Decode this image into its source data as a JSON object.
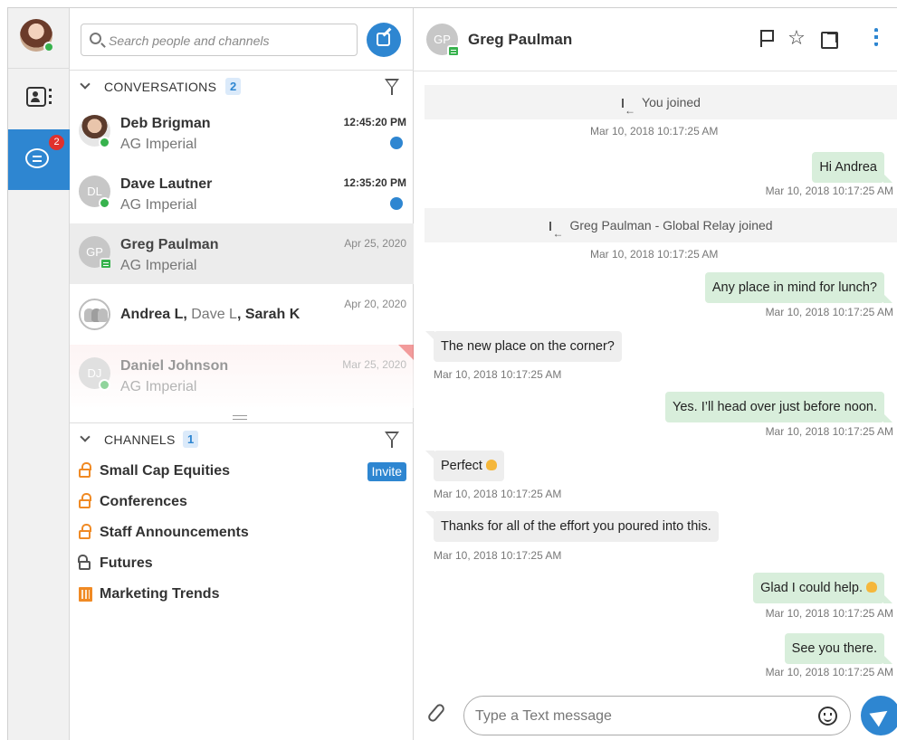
{
  "search": {
    "placeholder": "Search people and channels"
  },
  "rail": {
    "chats_badge": "2"
  },
  "conversations": {
    "title": "CONVERSATIONS",
    "count": "2",
    "items": [
      {
        "name": "Deb Brigman",
        "org": "AG Imperial",
        "time": "12:45:20 PM"
      },
      {
        "name": "Dave Lautner",
        "initials": "DL",
        "org": "AG Imperial",
        "time": "12:35:20 PM"
      },
      {
        "name": "Greg Paulman",
        "initials": "GP",
        "org": "AG Imperial",
        "time": "Apr 25, 2020"
      },
      {
        "group_names": [
          "Andrea L",
          "Dave L",
          "Sarah K"
        ],
        "sep": ", ",
        "time": "Apr 20, 2020"
      },
      {
        "name": "Daniel Johnson",
        "initials": "DJ",
        "org": "AG Imperial",
        "time": "Mar 25, 2020"
      }
    ]
  },
  "channels": {
    "title": "CHANNELS",
    "count": "1",
    "items": [
      {
        "label": "Small Cap Equities",
        "invite": "Invite"
      },
      {
        "label": "Conferences"
      },
      {
        "label": "Staff Announcements"
      },
      {
        "label": "Futures"
      },
      {
        "label": "Marketing Trends"
      }
    ]
  },
  "chat": {
    "initials": "GP",
    "name": "Greg Paulman",
    "messages": [
      {
        "kind": "system",
        "text": "You joined"
      },
      {
        "kind": "ts",
        "text": "Mar 10, 2018 10:17:25 AM"
      },
      {
        "kind": "out",
        "text": "Hi Andrea"
      },
      {
        "kind": "ts",
        "text": "Mar 10, 2018 10:17:25 AM"
      },
      {
        "kind": "system",
        "text": "Greg Paulman - Global Relay joined"
      },
      {
        "kind": "ts",
        "text": "Mar 10, 2018 10:17:25 AM"
      },
      {
        "kind": "out",
        "text": "Any place in mind for lunch?"
      },
      {
        "kind": "ts",
        "text": "Mar 10, 2018 10:17:25 AM"
      },
      {
        "kind": "in",
        "text": "The new place on the corner?"
      },
      {
        "kind": "ts",
        "text": "Mar 10, 2018 10:17:25 AM"
      },
      {
        "kind": "out",
        "text": "Yes. I’ll head over just before noon."
      },
      {
        "kind": "ts",
        "text": "Mar 10, 2018 10:17:25 AM"
      },
      {
        "kind": "in",
        "text": "Perfect"
      },
      {
        "kind": "ts",
        "text": "Mar 10, 2018 10:17:25 AM"
      },
      {
        "kind": "in",
        "text": "Thanks for all of the effort you poured into this."
      },
      {
        "kind": "ts",
        "text": "Mar 10, 2018 10:17:25 AM"
      },
      {
        "kind": "out",
        "text": "Glad I could help."
      },
      {
        "kind": "ts",
        "text": "Mar 10, 2018 10:17:25 AM"
      },
      {
        "kind": "out",
        "text": "See you there."
      },
      {
        "kind": "ts",
        "text": "Mar 10, 2018 10:17:25 AM"
      }
    ]
  },
  "composer": {
    "placeholder": "Type a Text message"
  },
  "colors": {
    "accent": "#2e86d1",
    "online": "#37b24d",
    "outgoing": "#d8eedb",
    "incoming": "#eeeeee",
    "lock": "#f08a24"
  }
}
